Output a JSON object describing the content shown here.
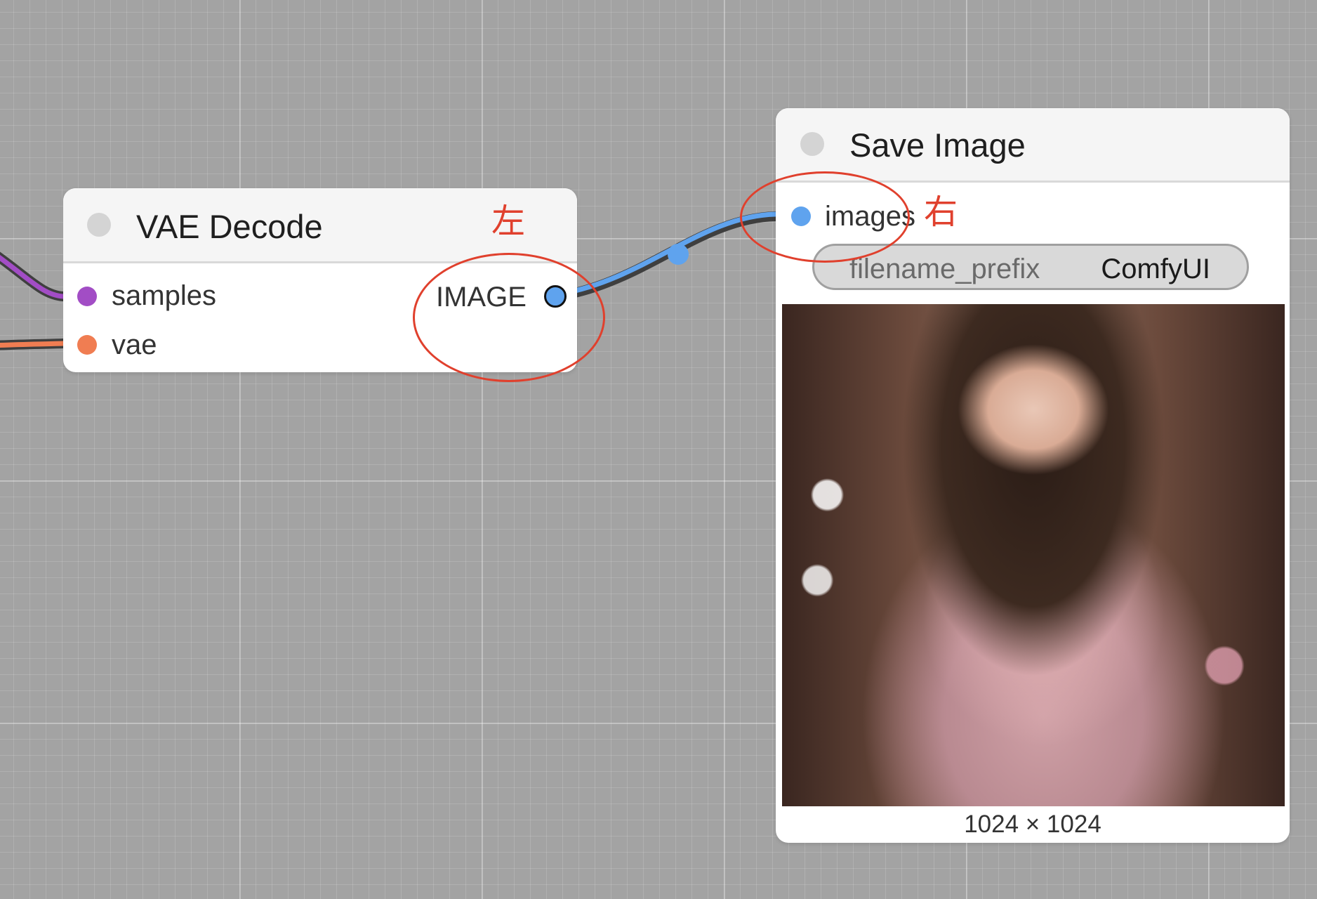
{
  "nodes": {
    "vae_decode": {
      "title": "VAE Decode",
      "inputs": [
        {
          "label": "samples",
          "color": "#a24dc5"
        },
        {
          "label": "vae",
          "color": "#f07d52"
        }
      ],
      "output": {
        "label": "IMAGE",
        "color": "#5fa3ee"
      }
    },
    "save_image": {
      "title": "Save Image",
      "input": {
        "label": "images",
        "color": "#5fa3ee"
      },
      "widget": {
        "name": "filename_prefix",
        "value": "ComfyUI"
      },
      "preview_dimensions": "1024 × 1024"
    }
  },
  "annotations": {
    "left_label": "左",
    "right_label": "右",
    "color": "#e0402d"
  },
  "colors": {
    "canvas": "#a3a3a3",
    "link_latent": "#a24dc5",
    "link_vae": "#f07d52",
    "link_image": "#5fa3ee"
  }
}
